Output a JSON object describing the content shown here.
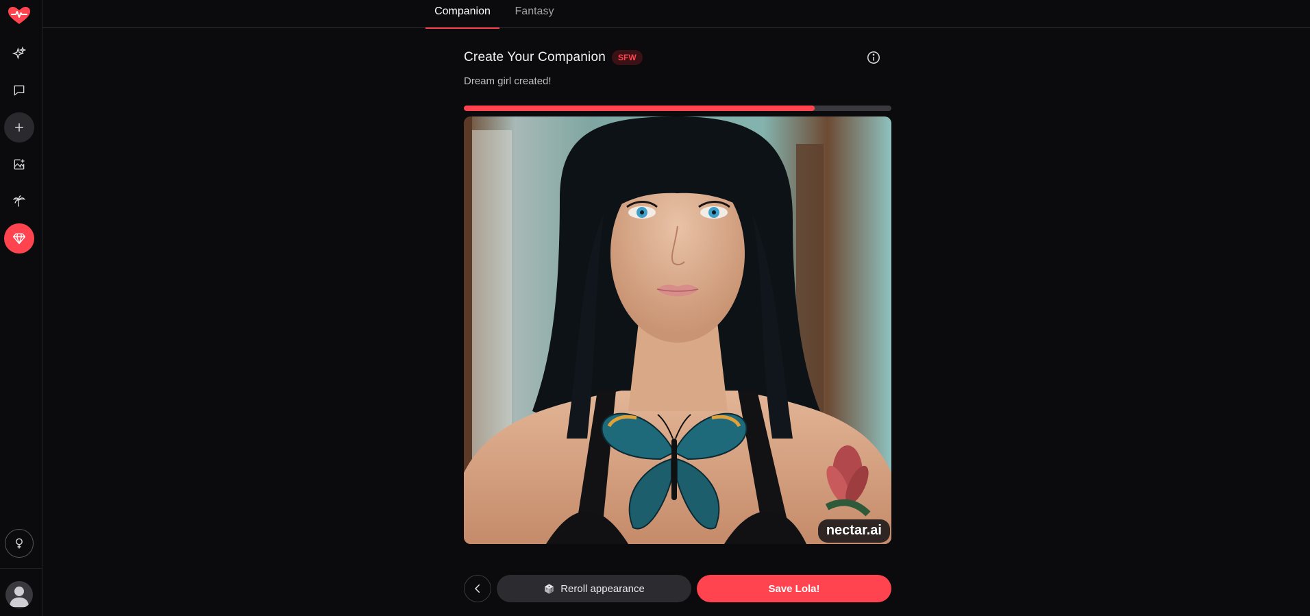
{
  "tabs": [
    {
      "label": "Companion",
      "active": true
    },
    {
      "label": "Fantasy",
      "active": false
    }
  ],
  "sidebar": {
    "items": [
      {
        "icon": "heart-pulse-logo-icon"
      },
      {
        "icon": "sparkles-icon"
      },
      {
        "icon": "chat-bubble-icon"
      },
      {
        "icon": "plus-icon"
      },
      {
        "icon": "image-add-icon"
      },
      {
        "icon": "palm-tree-icon"
      },
      {
        "icon": "diamond-icon"
      },
      {
        "icon": "female-symbol-icon"
      },
      {
        "icon": "avatar-icon"
      }
    ]
  },
  "main": {
    "title": "Create Your Companion",
    "badge": "SFW",
    "subtitle": "Dream girl created!",
    "progress": 0.82,
    "watermark": "nectar.ai"
  },
  "actions": {
    "reroll_label": "Reroll appearance",
    "save_label": "Save Lola!"
  },
  "colors": {
    "accent": "#ff4450",
    "background": "#0b0b0d"
  }
}
